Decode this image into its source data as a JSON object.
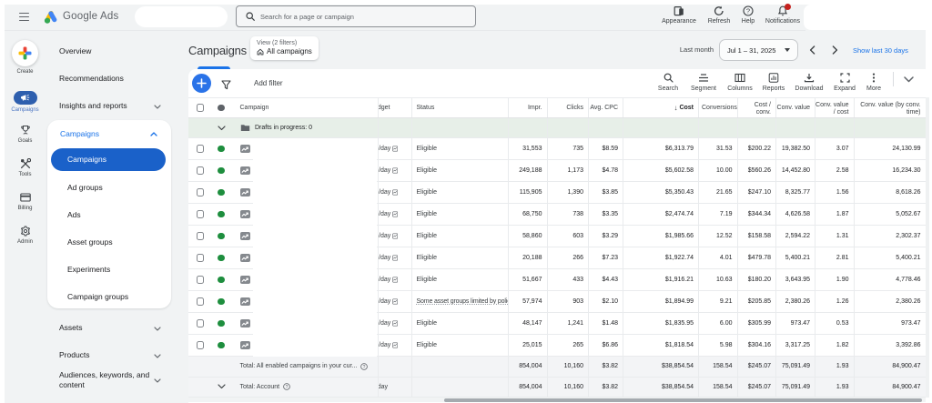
{
  "topbar": {
    "product": "Google Ads",
    "search_placeholder": "Search for a page or campaign",
    "actions": {
      "appearance": "Appearance",
      "refresh": "Refresh",
      "help": "Help",
      "notifications": "Notifications"
    }
  },
  "context": {
    "title": "Campaigns",
    "view_chip": {
      "line1": "View (2 filters)",
      "line2": "All campaigns"
    },
    "date_preset": "Last month",
    "date_range": "Jul 1 – 31, 2025",
    "show_last_link": "Show last 30 days"
  },
  "toolbar": {
    "add_filter": "Add filter",
    "actions": {
      "search": "Search",
      "segment": "Segment",
      "columns": "Columns",
      "reports": "Reports",
      "download": "Download",
      "expand": "Expand",
      "more": "More"
    }
  },
  "rail": {
    "create": "Create",
    "campaigns": "Campaigns",
    "goals": "Goals",
    "tools": "Tools",
    "billing": "Billing",
    "admin": "Admin"
  },
  "nav": {
    "top_items": [
      "Overview",
      "Recommendations",
      "Insights and reports"
    ],
    "section_label": "Campaigns",
    "section_items": [
      "Campaigns",
      "Ad groups",
      "Ads",
      "Asset groups",
      "Experiments",
      "Campaign groups"
    ],
    "selected_item": "Campaigns",
    "bottom_items": [
      "Assets",
      "Products",
      "Audiences, keywords, and content"
    ]
  },
  "table": {
    "headers": {
      "campaign": "Campaign",
      "budget": "Budget",
      "status": "Status",
      "impr": "Impr.",
      "clicks": "Clicks",
      "avg_cpc": "Avg. CPC",
      "cost": "Cost",
      "conversions": "Conversions",
      "cost_conv": "Cost / conv.",
      "conv_value": "Conv. value",
      "conv_value_cost": "Conv. value / cost",
      "conv_value_time": "Conv. value (by conv. time)"
    },
    "sorted_by": "Cost",
    "drafts_row_label": "Drafts in progress: 0",
    "budget_suffix": "/day",
    "rows": [
      {
        "status": "Eligible",
        "impr": "31,553",
        "clicks": "735",
        "avg_cpc": "$8.59",
        "cost": "$6,313.79",
        "conversions": "31.53",
        "cost_conv": "$200.22",
        "conv_value": "19,382.50",
        "conv_value_cost": "3.07",
        "conv_value_time": "24,130.99"
      },
      {
        "status": "Eligible",
        "impr": "249,188",
        "clicks": "1,173",
        "avg_cpc": "$4.78",
        "cost": "$5,602.58",
        "conversions": "10.00",
        "cost_conv": "$560.26",
        "conv_value": "14,452.80",
        "conv_value_cost": "2.58",
        "conv_value_time": "16,234.30"
      },
      {
        "status": "Eligible",
        "impr": "115,905",
        "clicks": "1,390",
        "avg_cpc": "$3.85",
        "cost": "$5,350.43",
        "conversions": "21.65",
        "cost_conv": "$247.10",
        "conv_value": "8,325.77",
        "conv_value_cost": "1.56",
        "conv_value_time": "8,618.26"
      },
      {
        "status": "Eligible",
        "impr": "68,750",
        "clicks": "738",
        "avg_cpc": "$3.35",
        "cost": "$2,474.74",
        "conversions": "7.19",
        "cost_conv": "$344.34",
        "conv_value": "4,626.58",
        "conv_value_cost": "1.87",
        "conv_value_time": "5,052.67"
      },
      {
        "status": "Eligible",
        "impr": "58,860",
        "clicks": "603",
        "avg_cpc": "$3.29",
        "cost": "$1,985.66",
        "conversions": "12.52",
        "cost_conv": "$158.58",
        "conv_value": "2,594.22",
        "conv_value_cost": "1.31",
        "conv_value_time": "2,302.37"
      },
      {
        "status": "Eligible",
        "impr": "20,188",
        "clicks": "266",
        "avg_cpc": "$7.23",
        "cost": "$1,922.74",
        "conversions": "4.01",
        "cost_conv": "$479.78",
        "conv_value": "5,400.21",
        "conv_value_cost": "2.81",
        "conv_value_time": "5,400.21"
      },
      {
        "status": "Eligible",
        "impr": "51,667",
        "clicks": "433",
        "avg_cpc": "$4.43",
        "cost": "$1,916.21",
        "conversions": "10.63",
        "cost_conv": "$180.20",
        "conv_value": "3,643.95",
        "conv_value_cost": "1.90",
        "conv_value_time": "4,778.46"
      },
      {
        "status": "Some asset groups limited by policy",
        "status_limited": true,
        "impr": "57,974",
        "clicks": "903",
        "avg_cpc": "$2.10",
        "cost": "$1,894.99",
        "conversions": "9.21",
        "cost_conv": "$205.85",
        "conv_value": "2,380.26",
        "conv_value_cost": "1.26",
        "conv_value_time": "2,380.26"
      },
      {
        "status": "Eligible",
        "impr": "48,147",
        "clicks": "1,241",
        "avg_cpc": "$1.48",
        "cost": "$1,835.95",
        "conversions": "6.00",
        "cost_conv": "$305.99",
        "conv_value": "973.47",
        "conv_value_cost": "0.53",
        "conv_value_time": "973.47"
      },
      {
        "status": "Eligible",
        "impr": "25,015",
        "clicks": "265",
        "avg_cpc": "$6.86",
        "cost": "$1,818.54",
        "conversions": "5.98",
        "cost_conv": "$304.16",
        "conv_value": "3,317.25",
        "conv_value_cost": "1.82",
        "conv_value_time": "3,392.86"
      }
    ],
    "totals": [
      {
        "label": "Total: All enabled campaigns in your cur...",
        "budget": "",
        "impr": "854,004",
        "clicks": "10,160",
        "avg_cpc": "$3.82",
        "cost": "$38,854.54",
        "conversions": "158.54",
        "cost_conv": "$245.07",
        "conv_value": "75,091.49",
        "conv_value_cost": "1.93",
        "conv_value_time": "84,900.47"
      },
      {
        "label": "Total: Account",
        "budget": "/day",
        "impr": "854,004",
        "clicks": "10,160",
        "avg_cpc": "$3.82",
        "cost": "$38,854.54",
        "conversions": "158.54",
        "cost_conv": "$245.07",
        "conv_value": "75,091.49",
        "conv_value_cost": "1.93",
        "conv_value_time": "84,900.47"
      }
    ]
  }
}
